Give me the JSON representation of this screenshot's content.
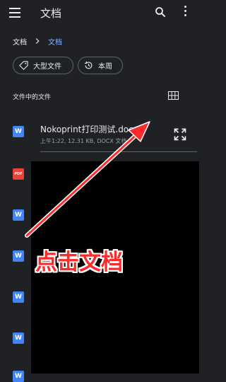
{
  "appbar": {
    "title": "文档"
  },
  "breadcrumb": {
    "root": "文档",
    "current": "文档"
  },
  "chips": [
    {
      "label": "大型文件",
      "icon": "tag-icon"
    },
    {
      "label": "本周",
      "icon": "history-icon"
    }
  ],
  "section": {
    "title": "文件中的文件"
  },
  "files": [
    {
      "name": "Nokoprint打印测试.docx",
      "meta": "上午1:22, 12.31 KB, DOCX 文档",
      "type": "W"
    },
    {
      "type": "PDF"
    },
    {
      "type": "W"
    },
    {
      "type": "W"
    },
    {
      "type": "W"
    },
    {
      "type": "W"
    },
    {
      "type": "W"
    }
  ],
  "annotation": {
    "text": "点击文档",
    "color": "#ff2a2a"
  },
  "colors": {
    "accent": "#8ab4f8",
    "background": "#202124",
    "word": "#4285f4",
    "pdf": "#ea4335"
  }
}
